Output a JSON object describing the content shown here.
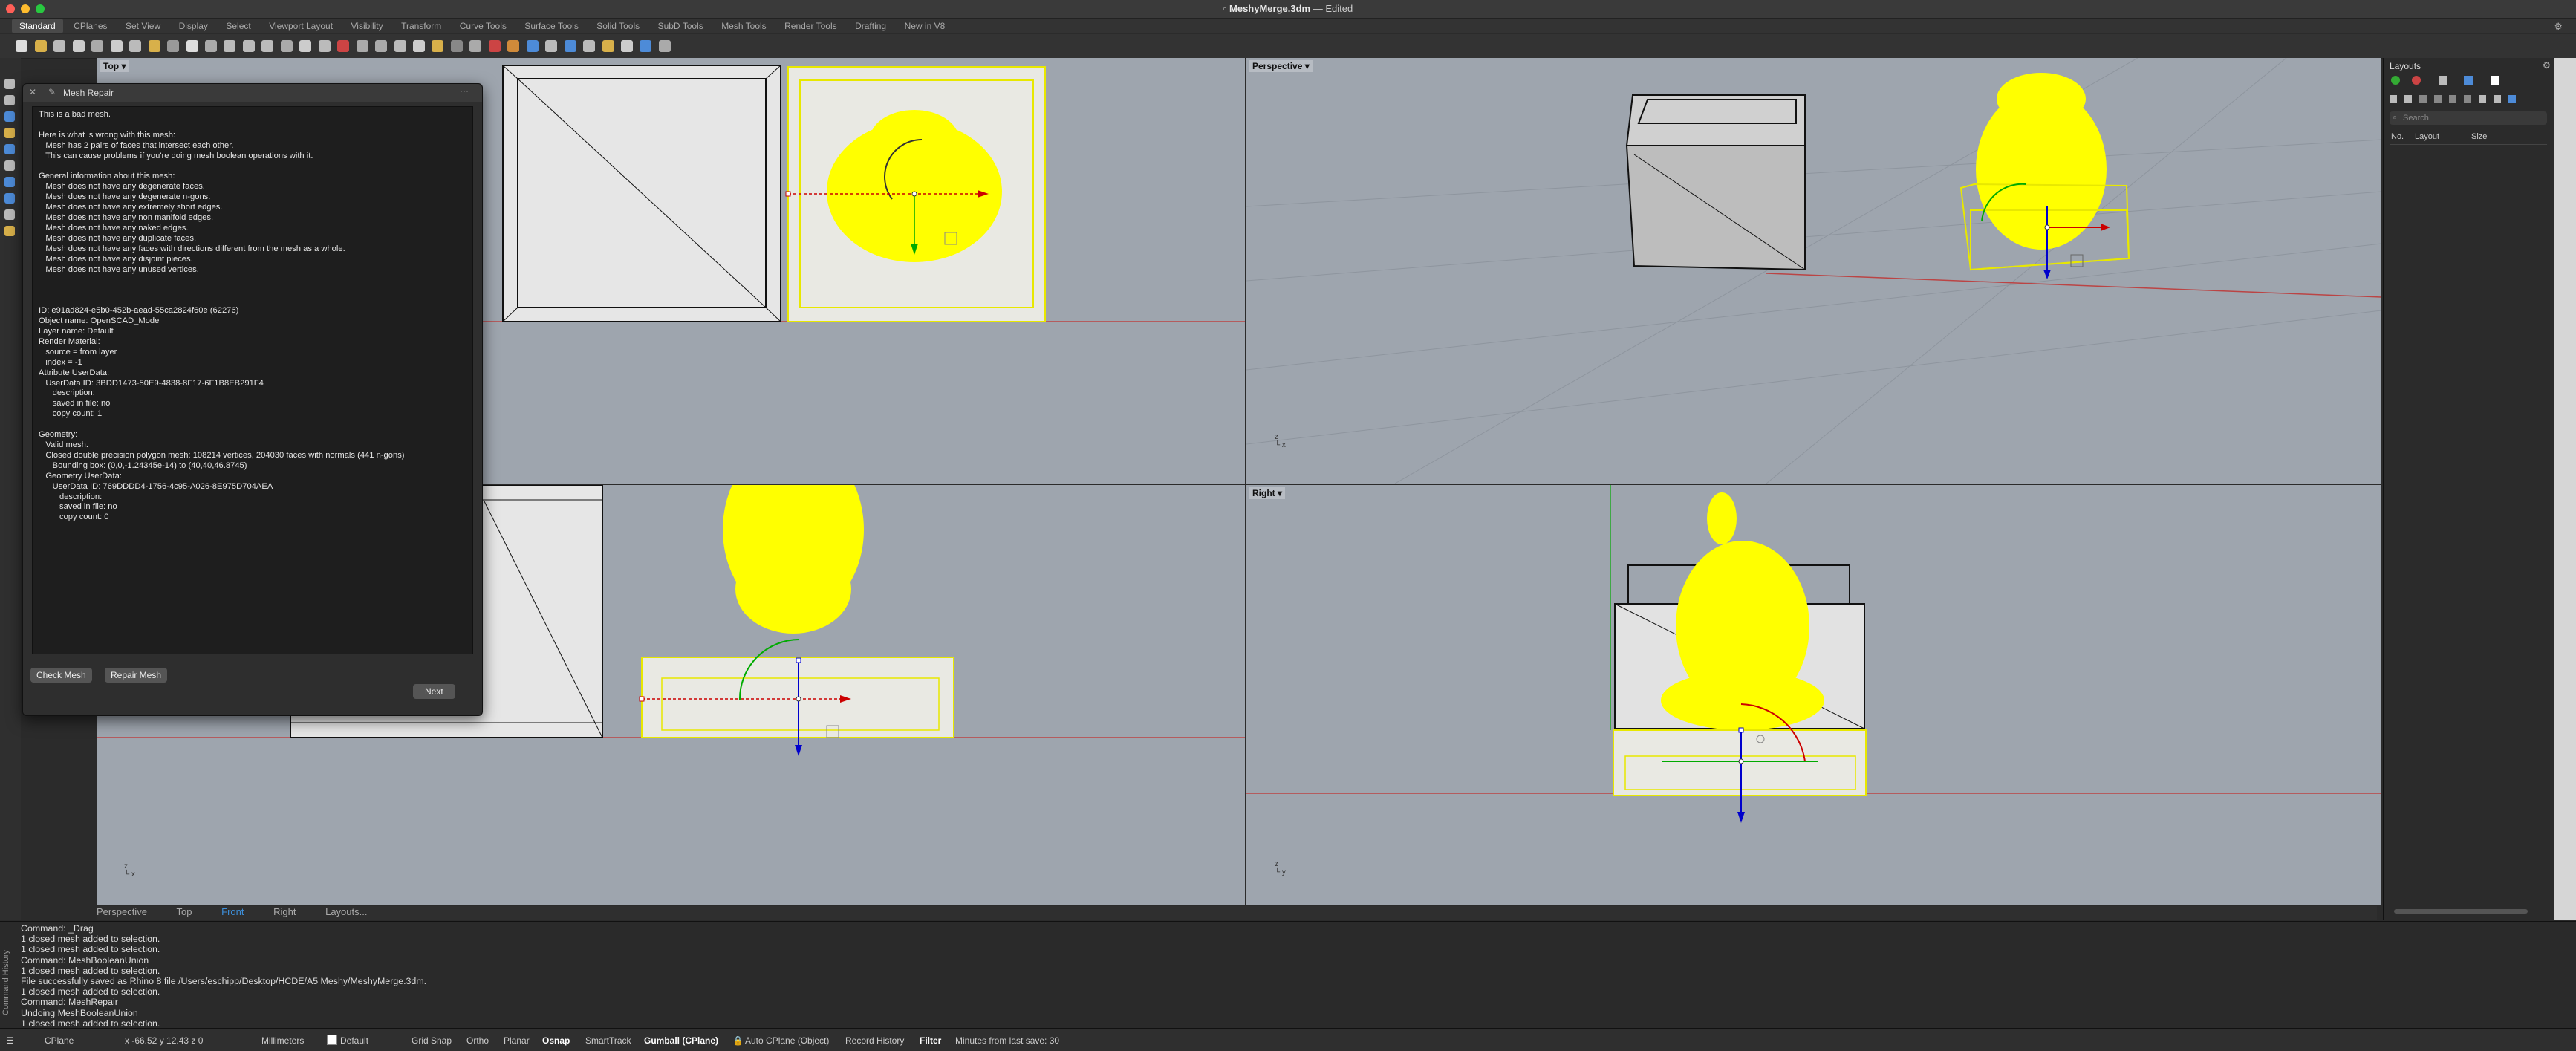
{
  "window": {
    "doc_name": "MeshyMerge.3dm",
    "doc_status": "— Edited",
    "traffic_colors": [
      "#ff5f57",
      "#febc2e",
      "#28c840"
    ]
  },
  "ribbon_tabs": [
    "Standard",
    "CPlanes",
    "Set View",
    "Display",
    "Select",
    "Viewport Layout",
    "Visibility",
    "Transform",
    "Curve Tools",
    "Surface Tools",
    "Solid Tools",
    "SubD Tools",
    "Mesh Tools",
    "Render Tools",
    "Drafting",
    "New in V8"
  ],
  "viewports": {
    "top": "Top",
    "perspective": "Perspective",
    "right": "Right"
  },
  "dialog": {
    "title": "Mesh Repair",
    "report_text": "This is a bad mesh.\n\nHere is what is wrong with this mesh:\n   Mesh has 2 pairs of faces that intersect each other.\n   This can cause problems if you're doing mesh boolean operations with it.\n\nGeneral information about this mesh:\n   Mesh does not have any degenerate faces.\n   Mesh does not have any degenerate n-gons.\n   Mesh does not have any extremely short edges.\n   Mesh does not have any non manifold edges.\n   Mesh does not have any naked edges.\n   Mesh does not have any duplicate faces.\n   Mesh does not have any faces with directions different from the mesh as a whole.\n   Mesh does not have any disjoint pieces.\n   Mesh does not have any unused vertices.\n\n\n\nID: e91ad824-e5b0-452b-aead-55ca2824f60e (62276)\nObject name: OpenSCAD_Model\nLayer name: Default\nRender Material:\n   source = from layer\n   index = -1\nAttribute UserData:\n   UserData ID: 3BDD1473-50E9-4838-8F17-6F1B8EB291F4\n      description:\n      saved in file: no\n      copy count: 1\n\nGeometry:\n   Valid mesh.\n   Closed double precision polygon mesh: 108214 vertices, 204030 faces with normals (441 n-gons)\n      Bounding box: (0,0,-1.24345e-14) to (40,40,46.8745)\n   Geometry UserData:\n      UserData ID: 769DDDD4-1756-4c95-A026-8E975D704AEA\n         description:\n         saved in file: no\n         copy count: 0",
    "check_mesh": "Check Mesh",
    "repair_mesh": "Repair Mesh",
    "next": "Next"
  },
  "viewport_tabs": [
    "Perspective",
    "Top",
    "Front",
    "Right",
    "Layouts..."
  ],
  "command_history_label": "Command History",
  "command_history": "Command: _Drag\n1 closed mesh added to selection.\n1 closed mesh added to selection.\nCommand: MeshBooleanUnion\n1 closed mesh added to selection.\nFile successfully saved as Rhino 8 file /Users/eschipp/Desktop/HCDE/A5 Meshy/MeshyMerge.3dm.\n1 closed mesh added to selection.\nCommand: MeshRepair\nUndoing MeshBooleanUnion\n1 closed mesh added to selection.",
  "statusbar": {
    "cplane": "CPlane",
    "coords": "x -66.52  y 12.43  z 0",
    "units": "Millimeters",
    "layer": "Default",
    "grid_snap": "Grid Snap",
    "ortho": "Ortho",
    "planar": "Planar",
    "osnap": "Osnap",
    "smarttrack": "SmartTrack",
    "gumball": "Gumball (CPlane)",
    "auto_cplane": "Auto CPlane (Object)",
    "record_history": "Record History",
    "filter": "Filter",
    "last_save": "Minutes from last save: 30"
  },
  "layouts_panel": {
    "title": "Layouts",
    "search_placeholder": "Search",
    "col_no": "No.",
    "col_layout": "Layout",
    "col_size": "Size"
  }
}
